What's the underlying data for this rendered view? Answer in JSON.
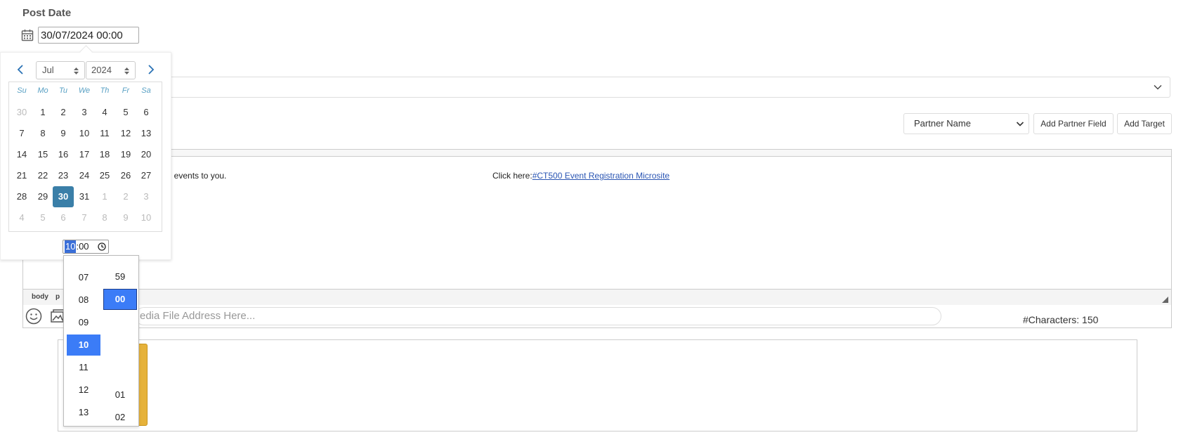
{
  "post_date": {
    "label": "Post Date",
    "value": "30/07/2024 00:00"
  },
  "partner": {
    "select_value": "Partner Name",
    "add_partner_label": "Add Partner Field",
    "add_target_label": "Add Target"
  },
  "editor": {
    "text_fragment": "al events to you.",
    "click_prefix": "Click here:",
    "link_text": "#CT500 Event Registration Microsite",
    "path": [
      "body",
      "p"
    ]
  },
  "media": {
    "placeholder": "edia File Address Here...",
    "characters_label": "#Characters: 150"
  },
  "datepicker": {
    "month": "Jul",
    "year": "2024",
    "weekdays": [
      "Su",
      "Mo",
      "Tu",
      "We",
      "Th",
      "Fr",
      "Sa"
    ],
    "weeks": [
      [
        [
          "30",
          "muted"
        ],
        [
          "1",
          ""
        ],
        [
          "2",
          ""
        ],
        [
          "3",
          ""
        ],
        [
          "4",
          ""
        ],
        [
          "5",
          ""
        ],
        [
          "6",
          ""
        ]
      ],
      [
        [
          "7",
          ""
        ],
        [
          "8",
          ""
        ],
        [
          "9",
          ""
        ],
        [
          "10",
          ""
        ],
        [
          "11",
          ""
        ],
        [
          "12",
          ""
        ],
        [
          "13",
          ""
        ]
      ],
      [
        [
          "14",
          ""
        ],
        [
          "15",
          ""
        ],
        [
          "16",
          ""
        ],
        [
          "17",
          ""
        ],
        [
          "18",
          ""
        ],
        [
          "19",
          ""
        ],
        [
          "20",
          ""
        ]
      ],
      [
        [
          "21",
          ""
        ],
        [
          "22",
          ""
        ],
        [
          "23",
          ""
        ],
        [
          "24",
          ""
        ],
        [
          "25",
          ""
        ],
        [
          "26",
          ""
        ],
        [
          "27",
          ""
        ]
      ],
      [
        [
          "28",
          ""
        ],
        [
          "29",
          ""
        ],
        [
          "30",
          "sel"
        ],
        [
          "31",
          ""
        ],
        [
          "1",
          "muted"
        ],
        [
          "2",
          "muted"
        ],
        [
          "3",
          "muted"
        ]
      ],
      [
        [
          "4",
          "muted"
        ],
        [
          "5",
          "muted"
        ],
        [
          "6",
          "muted"
        ],
        [
          "7",
          "muted"
        ],
        [
          "8",
          "muted"
        ],
        [
          "9",
          "muted"
        ],
        [
          "10",
          "muted"
        ]
      ]
    ],
    "time": {
      "hours": "10",
      "sep_minutes": ":00"
    },
    "hour_options": [
      "07",
      "08",
      "09",
      "10",
      "11",
      "12",
      "13"
    ],
    "selected_hour": "10",
    "minute_options_top": [
      "59",
      "00"
    ],
    "minute_options_bottom": [
      "01",
      "02"
    ],
    "selected_minute": "00"
  },
  "colors": {
    "selected_day": "#3a7fa8",
    "selected_option": "#3b7cf7",
    "link": "#2a55b3"
  }
}
